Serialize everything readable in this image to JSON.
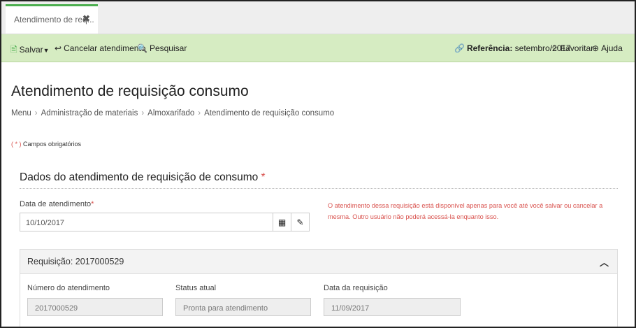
{
  "tab": {
    "label": "Atendimento de req...",
    "close": "✖"
  },
  "toolbar": {
    "save": "Salvar",
    "cancel": "Cancelar atendimento",
    "search": "Pesquisar",
    "reference_label": "Referência:",
    "reference_value": "setembro/2017",
    "favorite": "Favoritar",
    "help": "Ajuda"
  },
  "page": {
    "title": "Atendimento de requisição consumo",
    "breadcrumb": [
      "Menu",
      "Administração de materiais",
      "Almoxarifado",
      "Atendimento de requisição consumo"
    ],
    "required_note_par": "( * )",
    "required_note": "Campos obrigatórios"
  },
  "section": {
    "title": "Dados do atendimento de requisição de consumo",
    "star": "*",
    "date_label": "Data de atendimento",
    "date_star": "*",
    "date_value": "10/10/2017",
    "warning": "O atendimento dessa requisição está disponível apenas para você até você salvar ou cancelar a mesma. Outro usuário não poderá acessá-la enquanto isso."
  },
  "panel": {
    "title": "Requisição: 2017000529",
    "fields": [
      {
        "label": "Número do atendimento",
        "value": "2017000529"
      },
      {
        "label": "Status atual",
        "value": "Pronta para atendimento"
      },
      {
        "label": "Data da requisição",
        "value": "11/09/2017"
      }
    ]
  },
  "colors": {
    "accent_green": "#4caf50",
    "toolbar_bg": "#d6ecc2",
    "required_red": "#d9534f"
  },
  "icons": [
    "save-icon",
    "caret-down-icon",
    "reply-icon",
    "search-icon",
    "share-icon",
    "star-icon",
    "help-icon",
    "calendar-icon",
    "eraser-icon",
    "chevron-up-icon"
  ]
}
